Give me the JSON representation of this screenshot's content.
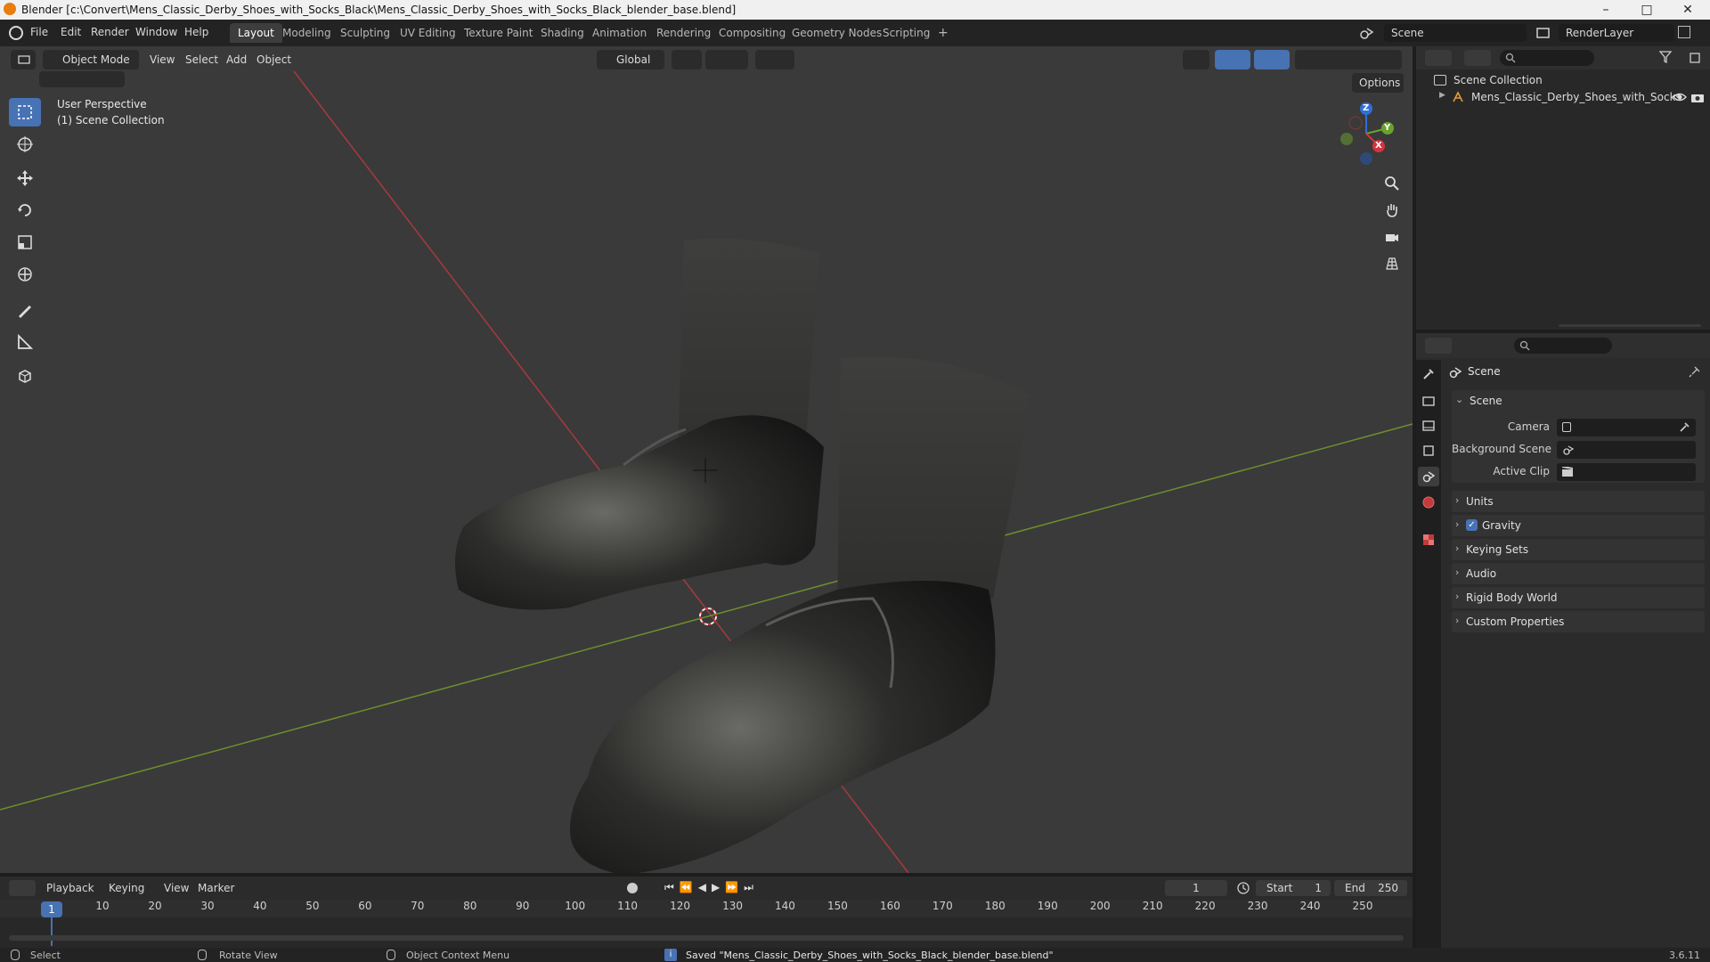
{
  "window": {
    "title": "Blender [c:\\Convert\\Mens_Classic_Derby_Shoes_with_Socks_Black\\Mens_Classic_Derby_Shoes_with_Socks_Black_blender_base.blend]",
    "minimize": "–",
    "maximize": "□",
    "close": "✕"
  },
  "menubar": {
    "items": [
      "File",
      "Edit",
      "Render",
      "Window",
      "Help"
    ]
  },
  "workspaces": {
    "tabs": [
      "Layout",
      "Modeling",
      "Sculpting",
      "UV Editing",
      "Texture Paint",
      "Shading",
      "Animation",
      "Rendering",
      "Compositing",
      "Geometry Nodes",
      "Scripting"
    ],
    "active": "Layout",
    "add": "+"
  },
  "scene_selector": {
    "value": "Scene"
  },
  "renderlayer_selector": {
    "value": "RenderLayer"
  },
  "viewport_header": {
    "mode": "Object Mode",
    "menus": [
      "View",
      "Select",
      "Add",
      "Object"
    ],
    "transform_orientation": "Global",
    "options": "Options"
  },
  "viewport_overlay": {
    "perspective": "User Perspective",
    "collection": "(1) Scene Collection"
  },
  "gizmo_axes": {
    "x": "X",
    "y": "Y",
    "z": "Z"
  },
  "toolbar": {
    "tools": [
      "select-box-icon",
      "cursor-icon",
      "move-icon",
      "rotate-icon",
      "scale-icon",
      "transform-icon",
      "annotate-icon",
      "measure-icon",
      "add-cube-icon"
    ]
  },
  "outliner": {
    "root": "Scene Collection",
    "items": [
      {
        "label": "Mens_Classic_Derby_Shoes_with_Socks"
      }
    ]
  },
  "properties": {
    "header": "Scene",
    "section": "Scene",
    "fields": {
      "camera_label": "Camera",
      "background_label": "Background Scene",
      "clip_label": "Active Clip"
    },
    "panels": [
      {
        "label": "Units",
        "checkbox": false
      },
      {
        "label": "Gravity",
        "checkbox": true
      },
      {
        "label": "Keying Sets",
        "checkbox": false
      },
      {
        "label": "Audio",
        "checkbox": false
      },
      {
        "label": "Rigid Body World",
        "checkbox": false
      },
      {
        "label": "Custom Properties",
        "checkbox": false
      }
    ]
  },
  "timeline": {
    "menus": [
      "Playback",
      "Keying",
      "View",
      "Marker"
    ],
    "current_frame": "1",
    "start_label": "Start",
    "start_value": "1",
    "end_label": "End",
    "end_value": "250",
    "ticks": [
      "1",
      "10",
      "20",
      "30",
      "40",
      "50",
      "60",
      "70",
      "80",
      "90",
      "100",
      "110",
      "120",
      "130",
      "140",
      "150",
      "160",
      "170",
      "180",
      "190",
      "200",
      "210",
      "220",
      "230",
      "240",
      "250"
    ]
  },
  "statusbar": {
    "select": "Select",
    "rotate": "Rotate View",
    "context_menu": "Object Context Menu",
    "message": "Saved \"Mens_Classic_Derby_Shoes_with_Socks_Black_blender_base.blend\"",
    "version": "3.6.11"
  }
}
